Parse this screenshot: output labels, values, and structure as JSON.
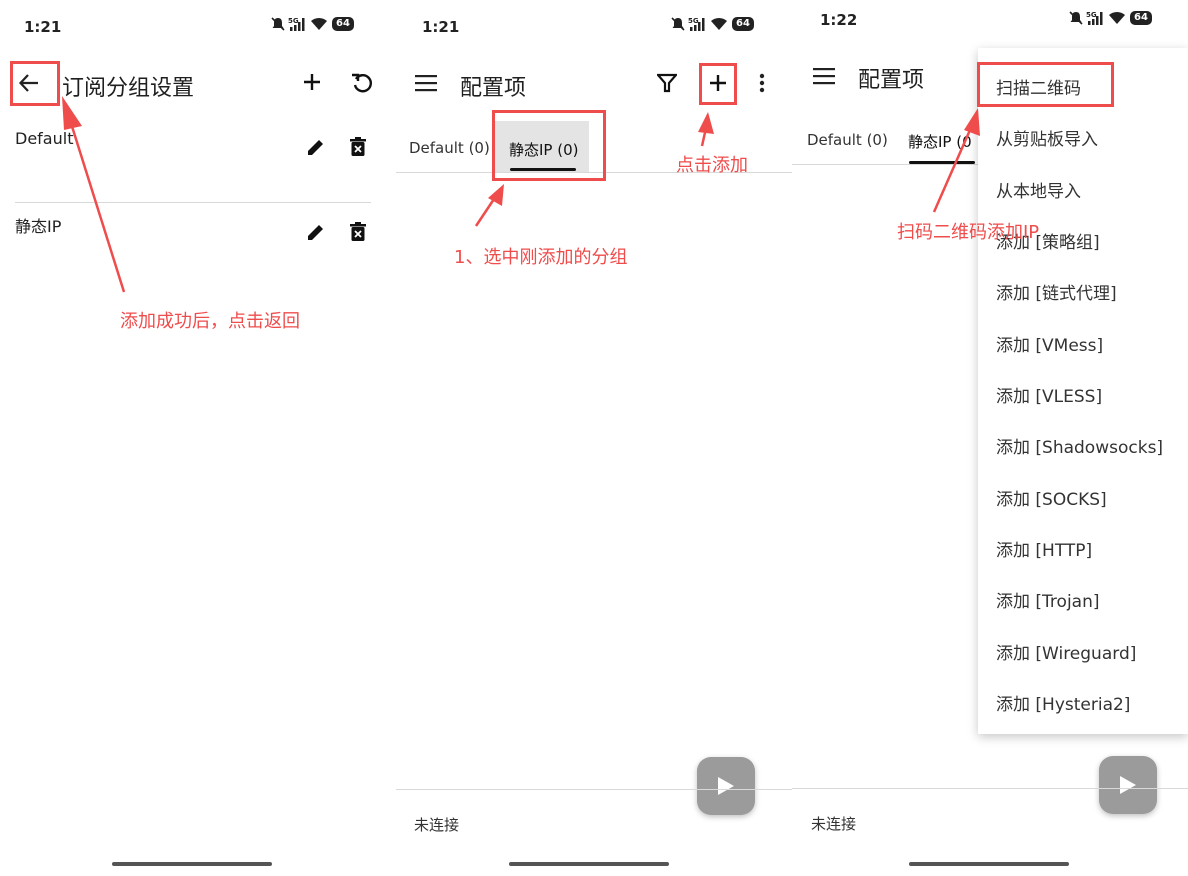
{
  "panel1": {
    "time": "1:21",
    "battery": "64",
    "title": "订阅分组设置",
    "rows": [
      {
        "label": "Default"
      },
      {
        "label": "静态IP"
      }
    ],
    "annotation": "添加成功后，点击返回"
  },
  "panel2": {
    "time": "1:21",
    "battery": "64",
    "title": "配置项",
    "tabs": [
      "Default (0)",
      "静态IP (0)"
    ],
    "annotation_select": "1、选中刚添加的分组",
    "annotation_add": "点击添加",
    "connection_status": "未连接"
  },
  "panel3": {
    "time": "1:22",
    "battery": "64",
    "title": "配置项",
    "tabs": [
      "Default (0)",
      "静态IP (0"
    ],
    "annotation": "扫码二维码添加IP",
    "connection_status": "未连接",
    "menu_items": [
      "扫描二维码",
      "从剪贴板导入",
      "从本地导入",
      "添加 [策略组]",
      "添加 [链式代理]",
      "添加 [VMess]",
      "添加 [VLESS]",
      "添加 [Shadowsocks]",
      "添加 [SOCKS]",
      "添加 [HTTP]",
      "添加 [Trojan]",
      "添加 [Wireguard]",
      "添加 [Hysteria2]"
    ]
  },
  "colors": {
    "annotation_red": "#ef4c4c",
    "fab_gray": "#9b9b9b",
    "tab_selected_bg": "#e4e4e4"
  },
  "icons": [
    "back-arrow-icon",
    "plus-icon",
    "refresh-icon",
    "edit-pencil-icon",
    "delete-icon",
    "hamburger-menu-icon",
    "filter-icon",
    "more-vert-icon",
    "play-icon",
    "mute-bell-icon",
    "signal-5g-icon",
    "wifi-icon",
    "battery-icon"
  ]
}
